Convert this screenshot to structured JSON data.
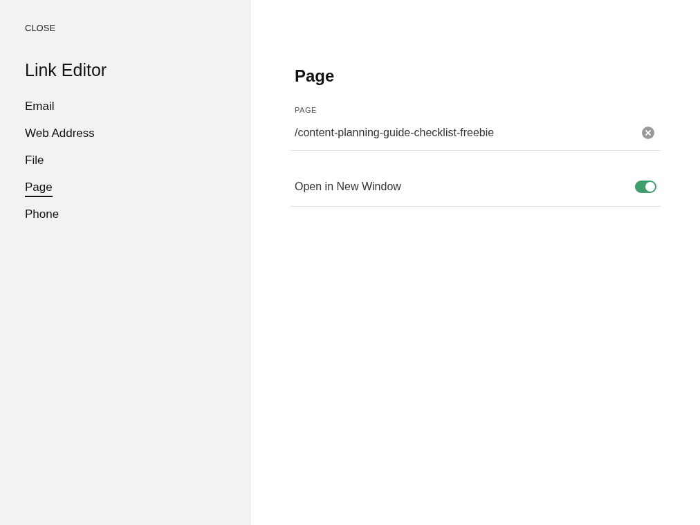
{
  "sidebar": {
    "close": "CLOSE",
    "title": "Link Editor",
    "items": [
      {
        "label": "Email",
        "selected": false
      },
      {
        "label": "Web Address",
        "selected": false
      },
      {
        "label": "File",
        "selected": false
      },
      {
        "label": "Page",
        "selected": true
      },
      {
        "label": "Phone",
        "selected": false
      }
    ]
  },
  "panel": {
    "title": "Page",
    "field": {
      "label": "PAGE",
      "value": "/content-planning-guide-checklist-freebie"
    },
    "toggle": {
      "label": "Open in New Window",
      "on": true
    }
  }
}
